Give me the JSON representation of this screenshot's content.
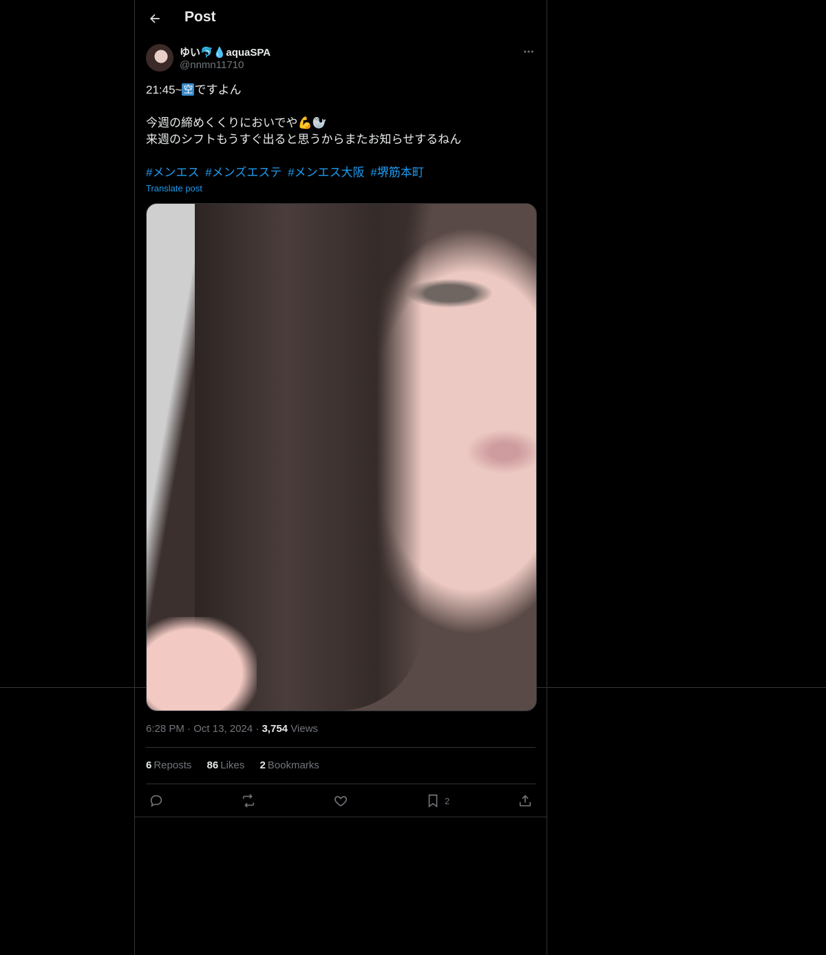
{
  "header": {
    "title": "Post",
    "back_icon": "arrow-left-icon"
  },
  "author": {
    "display_name": "ゆい🐬💧aquaSPA",
    "handle": "@nnmn11710"
  },
  "post": {
    "line1_prefix": "21:45~",
    "line1_badge": "空",
    "line1_suffix": "ですよん",
    "line2": "今週の締めくくりにおいでや💪🦭",
    "line3": "来週のシフトもうすぐ出ると思うからまたお知らせするねん",
    "hashtags": [
      "#メンエス",
      "#メンズエステ",
      "#メンエス大阪",
      "#堺筋本町"
    ],
    "translate_label": "Translate post"
  },
  "meta": {
    "time": "6:28 PM",
    "dot": "·",
    "date": "Oct 13, 2024",
    "views_count": "3,754",
    "views_label": "Views"
  },
  "stats": {
    "reposts_count": "6",
    "reposts_label": "Reposts",
    "likes_count": "86",
    "likes_label": "Likes",
    "bookmarks_count": "2",
    "bookmarks_label": "Bookmarks"
  },
  "actions": {
    "bookmark_count": "2"
  },
  "colors": {
    "background": "#000000",
    "text": "#e7e9ea",
    "muted": "#71767b",
    "link": "#1d9bf0",
    "border": "#2f3336"
  }
}
